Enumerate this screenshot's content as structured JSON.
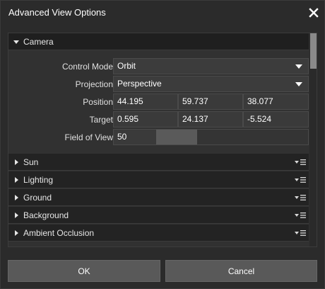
{
  "window": {
    "title": "Advanced View Options"
  },
  "camera": {
    "header": "Camera",
    "control_mode": {
      "label": "Control Mode",
      "value": "Orbit"
    },
    "projection": {
      "label": "Projection",
      "value": "Perspective"
    },
    "position": {
      "label": "Position",
      "x": "44.195",
      "y": "59.737",
      "z": "38.077"
    },
    "target": {
      "label": "Target",
      "x": "0.595",
      "y": "24.137",
      "z": "-5.524"
    },
    "fov": {
      "label": "Field of View",
      "value": "50"
    }
  },
  "sections": [
    {
      "label": "Sun"
    },
    {
      "label": "Lighting"
    },
    {
      "label": "Ground"
    },
    {
      "label": "Background"
    },
    {
      "label": "Ambient Occlusion"
    }
  ],
  "footer": {
    "ok": "OK",
    "cancel": "Cancel"
  },
  "icons": {
    "close": "close-icon",
    "expanded": "triangle-down-icon",
    "collapsed": "triangle-right-icon",
    "menu": "dropdown-menu-icon"
  }
}
